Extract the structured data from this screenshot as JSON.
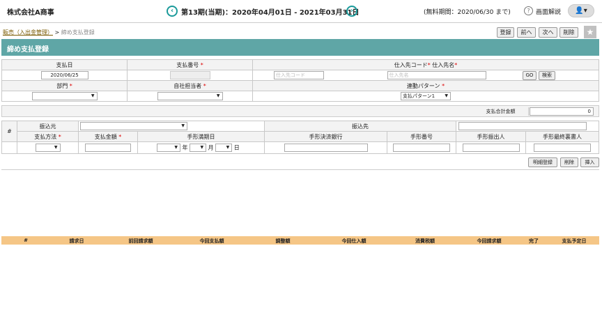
{
  "header": {
    "company": "株式会社A商事",
    "period": "第13期(当期)：2020年04月01日 - 2021年03月31日",
    "trial": "(無料期間：2020/06/30 まで)",
    "help": "画面解説",
    "prev_icon": "chevron-left-icon",
    "next_icon": "chevron-right-icon",
    "user_icon": "user-icon"
  },
  "breadcrumb": {
    "parent": "販売（入出金管理）",
    "sep": ">",
    "current": "締め支払登録"
  },
  "toolbar": {
    "register": "登録",
    "prev": "前へ",
    "next": "次へ",
    "delete": "削除"
  },
  "page_title": "締め支払登録",
  "form": {
    "pay_date_label": "支払日",
    "pay_date_value": "2020/06/25",
    "pay_no_label": "支払番号",
    "supplier_label1": "仕入先コード",
    "supplier_label2": "仕入先名",
    "supplier_code_ph": "仕入先コード",
    "supplier_name_ph": "仕入先名",
    "go": "GO",
    "search": "検索",
    "dept_label": "部門",
    "staff_label": "自社担当者",
    "link_label": "連動パターン",
    "link_value": "支払パターン1"
  },
  "total": {
    "label": "支払合計金額",
    "value": "0"
  },
  "detail": {
    "no": "#",
    "from_label": "振込元",
    "to_label": "振込先",
    "method_label": "支払方法",
    "amount_label": "支払金額",
    "due_label": "手形満期日",
    "year": "年",
    "month": "月",
    "day": "日",
    "bank_label": "手形決済銀行",
    "bill_no_label": "手形番号",
    "issuer_label": "手形振出人",
    "endorser_label": "手形最終裏書人"
  },
  "detail_buttons": {
    "register": "明細登録",
    "delete": "削除",
    "insert": "挿入"
  },
  "list_columns": [
    "#",
    "請求日",
    "前回請求額",
    "今回支払額",
    "調整額",
    "今回仕入額",
    "消費税額",
    "今回請求額",
    "完了",
    "支払予定日"
  ],
  "colors": {
    "accent": "#1a9a9a",
    "header_bg": "#5fa6a6",
    "list_head": "#f5c686"
  }
}
